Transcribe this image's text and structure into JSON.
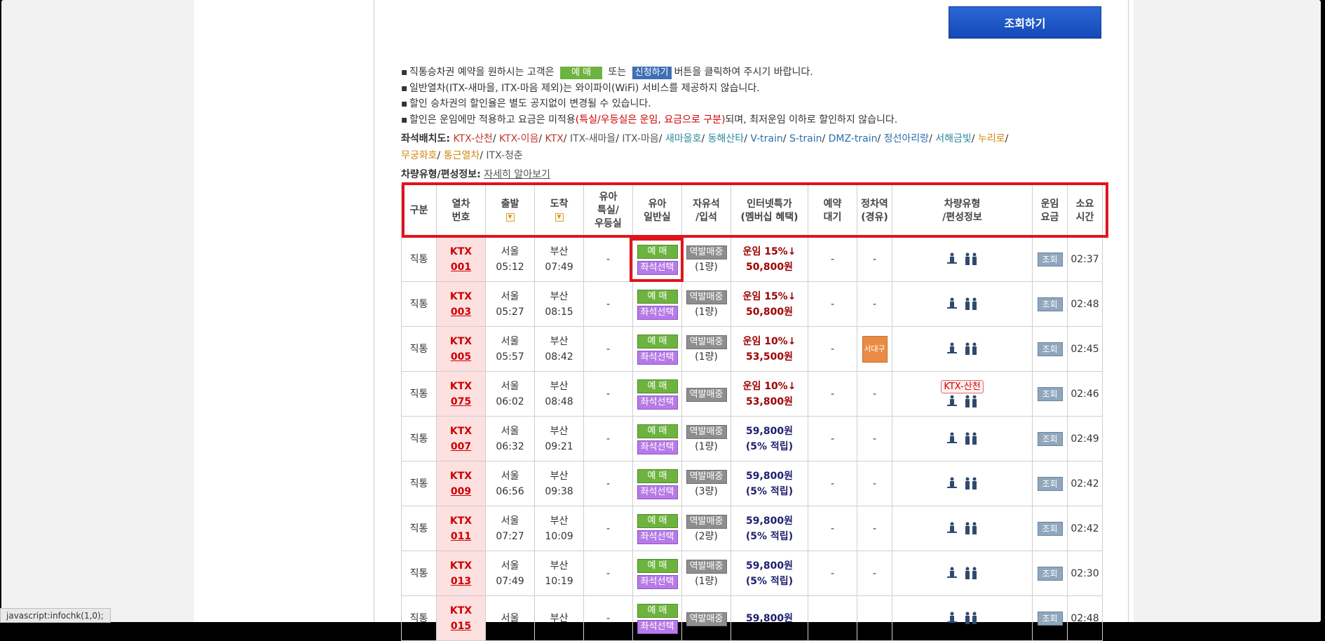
{
  "search_button": "조회하기",
  "notices": [
    {
      "pre": "직통승차권 예약을 원하시는 고객은",
      "btn_green": "예 매",
      "mid": "또는",
      "btn_blue": "신청하기",
      "post": "버튼을 클릭하여 주시기 바랍니다."
    },
    {
      "text": "일반열차(ITX-새마을, ITX-마음 제외)는 와이파이(WiFi) 서비스를 제공하지 않습니다."
    },
    {
      "text": "할인 승차권의 할인율은 별도 공지없이 변경될 수 있습니다."
    },
    {
      "pre": "할인은 운임에만 적용하고 요금은 미적용",
      "red": "(특실/우등실은 운임, 요금으로 구분)",
      "post": "되며, 최저운임 이하로 할인하지 않습니다."
    }
  ],
  "seat_layout": {
    "label": "좌석배치도:",
    "links": [
      {
        "text": "KTX-산천",
        "color": "#c0392b"
      },
      {
        "text": "KTX-이음",
        "color": "#c0392b"
      },
      {
        "text": "KTX",
        "color": "#c0392b"
      },
      {
        "text": "ITX-새마을",
        "color": "#555555"
      },
      {
        "text": "ITX-마음",
        "color": "#555555"
      },
      {
        "text": "새마을호",
        "color": "#2a8aa0"
      },
      {
        "text": "동해산타",
        "color": "#2a8aa0"
      },
      {
        "text": "V-train",
        "color": "#2a6fb0"
      },
      {
        "text": "S-train",
        "color": "#2a6fb0"
      },
      {
        "text": "DMZ-train",
        "color": "#2a6fb0"
      },
      {
        "text": "정선아리랑",
        "color": "#2a6fb0"
      },
      {
        "text": "서해금빛",
        "color": "#2a8aa0"
      },
      {
        "text": "누리로",
        "color": "#d4870f"
      },
      {
        "text": "무궁화호",
        "color": "#d4870f"
      },
      {
        "text": "통근열차",
        "color": "#d4870f"
      },
      {
        "text": "ITX-청춘",
        "color": "#555555"
      }
    ]
  },
  "car_type_info": {
    "label": "차량유형/편성정보:",
    "link": "자세히 알아보기"
  },
  "headers": {
    "division": [
      "구분"
    ],
    "train_no": [
      "열차",
      "번호"
    ],
    "departure": [
      "출발"
    ],
    "arrival": [
      "도착"
    ],
    "infant_special": [
      "유아",
      "특실/",
      "우등실"
    ],
    "infant_general": [
      "유아",
      "일반실"
    ],
    "standing": [
      "자유석",
      "/입석"
    ],
    "internet_special": [
      "인터넷특가",
      "(멤버십 혜택)"
    ],
    "waitlist": [
      "예약",
      "대기"
    ],
    "stop_station": [
      "정차역",
      "(경유)"
    ],
    "car_type": [
      "차량유형",
      "/편성정보"
    ],
    "fare": [
      "운임",
      "요금"
    ],
    "duration": [
      "소요",
      "시간"
    ]
  },
  "sort_icon": "▼",
  "buttons": {
    "book": "예 매",
    "seat_select": "좌석선택",
    "station_sale": "역발매중",
    "lookup": "조회"
  },
  "rows": [
    {
      "division": "직통",
      "train_type": "KTX",
      "train_no": "001",
      "dep_station": "서울",
      "dep_time": "05:12",
      "arr_station": "부산",
      "arr_time": "07:49",
      "infant_special": "-",
      "standing_cars": "(1량)",
      "fare_line1": "운임 15%↓",
      "fare_line2": "50,800원",
      "fare_style": "red",
      "waitlist": "-",
      "stop": "-",
      "stop_badge": "",
      "car_badge": "",
      "fare_btn": "조회",
      "duration": "02:37"
    },
    {
      "division": "직통",
      "train_type": "KTX",
      "train_no": "003",
      "dep_station": "서울",
      "dep_time": "05:27",
      "arr_station": "부산",
      "arr_time": "08:15",
      "infant_special": "-",
      "standing_cars": "(1량)",
      "fare_line1": "운임 15%↓",
      "fare_line2": "50,800원",
      "fare_style": "red",
      "waitlist": "-",
      "stop": "-",
      "stop_badge": "",
      "car_badge": "",
      "fare_btn": "조회",
      "duration": "02:48"
    },
    {
      "division": "직통",
      "train_type": "KTX",
      "train_no": "005",
      "dep_station": "서울",
      "dep_time": "05:57",
      "arr_station": "부산",
      "arr_time": "08:42",
      "infant_special": "-",
      "standing_cars": "(1량)",
      "fare_line1": "운임 10%↓",
      "fare_line2": "53,500원",
      "fare_style": "red",
      "waitlist": "-",
      "stop": "",
      "stop_badge": "서대구",
      "car_badge": "",
      "fare_btn": "조회",
      "duration": "02:45"
    },
    {
      "division": "직통",
      "train_type": "KTX",
      "train_no": "075",
      "dep_station": "서울",
      "dep_time": "06:02",
      "arr_station": "부산",
      "arr_time": "08:48",
      "infant_special": "-",
      "standing_cars": "",
      "fare_line1": "운임 10%↓",
      "fare_line2": "53,800원",
      "fare_style": "red",
      "waitlist": "-",
      "stop": "-",
      "stop_badge": "",
      "car_badge": "KTX-산천",
      "fare_btn": "조회",
      "duration": "02:46"
    },
    {
      "division": "직통",
      "train_type": "KTX",
      "train_no": "007",
      "dep_station": "서울",
      "dep_time": "06:32",
      "arr_station": "부산",
      "arr_time": "09:21",
      "infant_special": "-",
      "standing_cars": "(1량)",
      "fare_line1": "59,800원",
      "fare_line2": "(5% 적립)",
      "fare_style": "navy",
      "waitlist": "-",
      "stop": "-",
      "stop_badge": "",
      "car_badge": "",
      "fare_btn": "조회",
      "duration": "02:49"
    },
    {
      "division": "직통",
      "train_type": "KTX",
      "train_no": "009",
      "dep_station": "서울",
      "dep_time": "06:56",
      "arr_station": "부산",
      "arr_time": "09:38",
      "infant_special": "-",
      "standing_cars": "(3량)",
      "fare_line1": "59,800원",
      "fare_line2": "(5% 적립)",
      "fare_style": "navy",
      "waitlist": "-",
      "stop": "-",
      "stop_badge": "",
      "car_badge": "",
      "fare_btn": "조회",
      "duration": "02:42"
    },
    {
      "division": "직통",
      "train_type": "KTX",
      "train_no": "011",
      "dep_station": "서울",
      "dep_time": "07:27",
      "arr_station": "부산",
      "arr_time": "10:09",
      "infant_special": "-",
      "standing_cars": "(2량)",
      "fare_line1": "59,800원",
      "fare_line2": "(5% 적립)",
      "fare_style": "navy",
      "waitlist": "-",
      "stop": "-",
      "stop_badge": "",
      "car_badge": "",
      "fare_btn": "조회",
      "duration": "02:42"
    },
    {
      "division": "직통",
      "train_type": "KTX",
      "train_no": "013",
      "dep_station": "서울",
      "dep_time": "07:49",
      "arr_station": "부산",
      "arr_time": "10:19",
      "infant_special": "-",
      "standing_cars": "(1량)",
      "fare_line1": "59,800원",
      "fare_line2": "(5% 적립)",
      "fare_style": "navy",
      "waitlist": "-",
      "stop": "-",
      "stop_badge": "",
      "car_badge": "",
      "fare_btn": "조회",
      "duration": "02:30"
    },
    {
      "division": "직통",
      "train_type": "KTX",
      "train_no": "015",
      "dep_station": "서울",
      "dep_time": "",
      "arr_station": "부산",
      "arr_time": "",
      "infant_special": "-",
      "standing_cars": "",
      "fare_line1": "59,800원",
      "fare_line2": "",
      "fare_style": "navy",
      "waitlist": "",
      "stop": "",
      "stop_badge": "",
      "car_badge": "",
      "fare_btn": "조회",
      "duration": "02:48"
    }
  ],
  "status_bar": "javascript:infochk(1,0);",
  "colors": {
    "highlight_outline": "#e0141e",
    "book_green": "#6db33f",
    "seat_purple": "#b67be6",
    "train_no_bg": "#fde0e0"
  }
}
